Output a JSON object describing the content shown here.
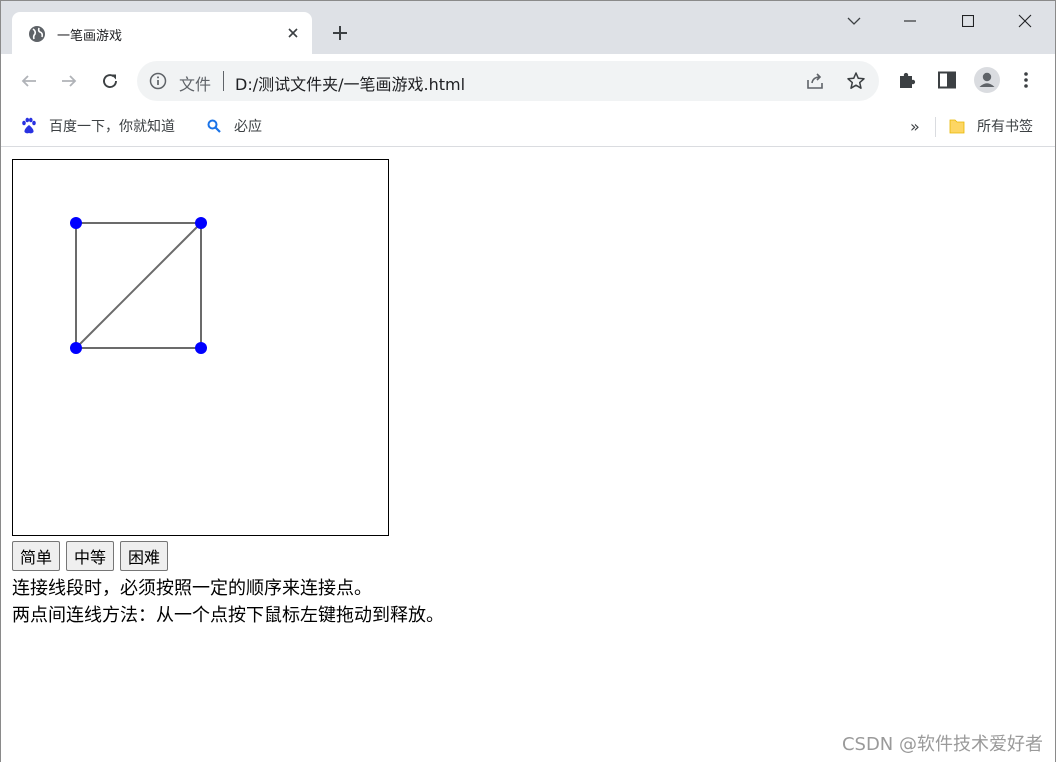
{
  "tab": {
    "title": "一笔画游戏",
    "close_icon": "close-icon",
    "favicon": "globe-icon"
  },
  "new_tab_icon": "plus-icon",
  "window_controls": {
    "tab_search": "chevron-down-icon",
    "minimize": "minimize-icon",
    "maximize": "maximize-icon",
    "close": "close-icon"
  },
  "toolbar": {
    "back": "back-arrow-icon",
    "forward": "forward-arrow-icon",
    "reload": "reload-icon",
    "site_chip": "文件",
    "url": "D:/测试文件夹/一笔画游戏.html",
    "share": "share-icon",
    "bookmark_star": "star-icon",
    "extensions": "puzzle-icon",
    "side_panel": "side-panel-icon",
    "profile": "profile-icon",
    "menu": "kebab-menu-icon"
  },
  "bookmarks": {
    "items": [
      {
        "label": "百度一下，你就知道",
        "icon": "baidu-paw-icon"
      },
      {
        "label": "必应",
        "icon": "bing-search-icon"
      }
    ],
    "overflow": "»",
    "all_bookmarks": "所有书签",
    "all_bookmarks_icon": "folder-icon"
  },
  "game": {
    "point_color": "#0000ff",
    "line_color": "#6b6b6b",
    "buttons": {
      "easy": "简单",
      "medium": "中等",
      "hard": "困难"
    },
    "instructions": [
      "连接线段时，必须按照一定的顺序来连接点。",
      "两点间连线方法：从一个点按下鼠标左键拖动到释放。"
    ]
  },
  "watermark": "CSDN @软件技术爱好者"
}
